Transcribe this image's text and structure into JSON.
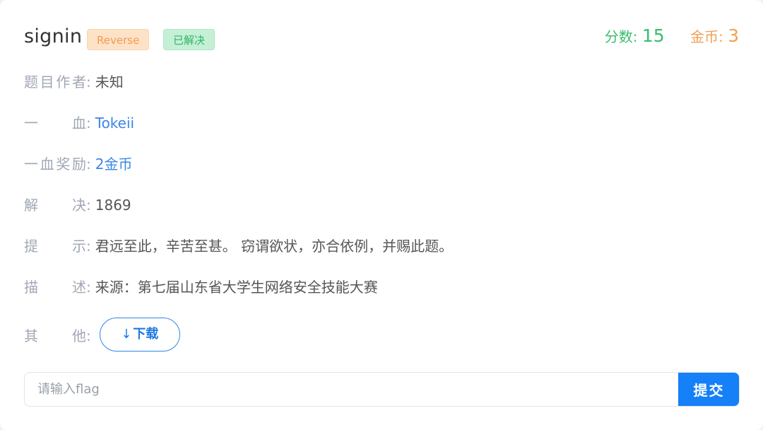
{
  "challenge": {
    "title": "signin",
    "category_tag": "Reverse",
    "status_tag": "已解决",
    "score_label": "分数:",
    "score_value": "15",
    "coin_label": "金币:",
    "coin_value": "3"
  },
  "colors": {
    "accent_blue": "#1580f7",
    "score_green": "#3bbd6e",
    "coin_orange": "#f2a052",
    "tag_category_bg": "#fde2c8",
    "tag_solved_bg": "#c6f0d6"
  },
  "details": {
    "author_label": "题目作者",
    "author_value": "未知",
    "first_blood_label": "一血",
    "first_blood_value": "Tokeii",
    "first_blood_reward_label": "一血奖励",
    "first_blood_reward_value": "2金币",
    "solves_label": "解决",
    "solves_value": "1869",
    "hint_label": "提示",
    "hint_value": "君远至此，辛苦至甚。 窃谓欲状，亦合依例，并赐此题。",
    "description_label": "描述",
    "description_value": "来源：第七届山东省大学生网络安全技能大赛",
    "other_label": "其他",
    "download_icon": "download-arrow-icon",
    "download_label": "下载",
    "colon": ":"
  },
  "submit": {
    "placeholder": "请输入flag",
    "button_label": "提交"
  }
}
